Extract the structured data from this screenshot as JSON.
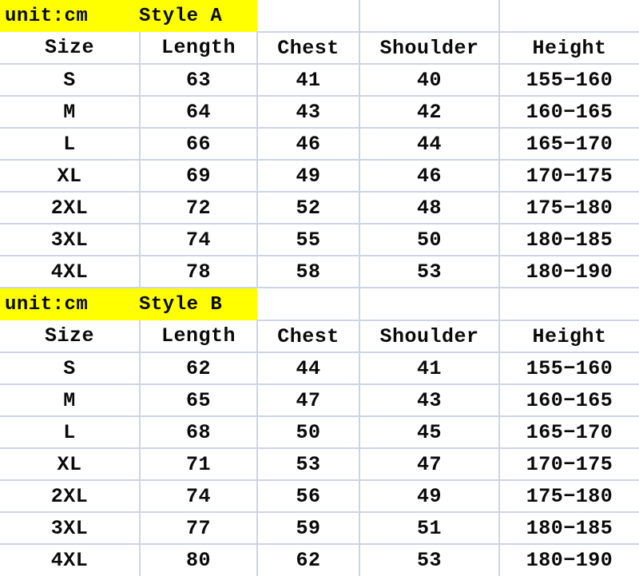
{
  "table": {
    "unit_label": "unit:cm",
    "columns": [
      "Size",
      "Length",
      "Chest",
      "Shoulder",
      "Height"
    ],
    "sections": [
      {
        "style_label": "Style A",
        "headers": [
          "Size",
          "Length",
          "Chest",
          "Shoulder",
          "Height"
        ],
        "rows": [
          [
            "S",
            "63",
            "41",
            "40",
            "155−160"
          ],
          [
            "M",
            "64",
            "43",
            "42",
            "160−165"
          ],
          [
            "L",
            "66",
            "46",
            "44",
            "165−170"
          ],
          [
            "XL",
            "69",
            "49",
            "46",
            "170−175"
          ],
          [
            "2XL",
            "72",
            "52",
            "48",
            "175−180"
          ],
          [
            "3XL",
            "74",
            "55",
            "50",
            "180−185"
          ],
          [
            "4XL",
            "78",
            "58",
            "53",
            "180−190"
          ]
        ]
      },
      {
        "style_label": "Style B",
        "headers": [
          "Size",
          "Length",
          "Chest",
          "Shoulder",
          "Height"
        ],
        "rows": [
          [
            "S",
            "62",
            "44",
            "41",
            "155−160"
          ],
          [
            "M",
            "65",
            "47",
            "43",
            "160−165"
          ],
          [
            "L",
            "68",
            "50",
            "45",
            "165−170"
          ],
          [
            "XL",
            "71",
            "53",
            "47",
            "170−175"
          ],
          [
            "2XL",
            "74",
            "56",
            "49",
            "175−180"
          ],
          [
            "3XL",
            "77",
            "59",
            "51",
            "180−185"
          ],
          [
            "4XL",
            "80",
            "62",
            "53",
            "180−190"
          ]
        ]
      }
    ],
    "colors": {
      "banner_background": "#FFFF00",
      "border": "#ccd4e6",
      "text": "#0a0a0a",
      "cell_background": "#ffffff"
    }
  }
}
